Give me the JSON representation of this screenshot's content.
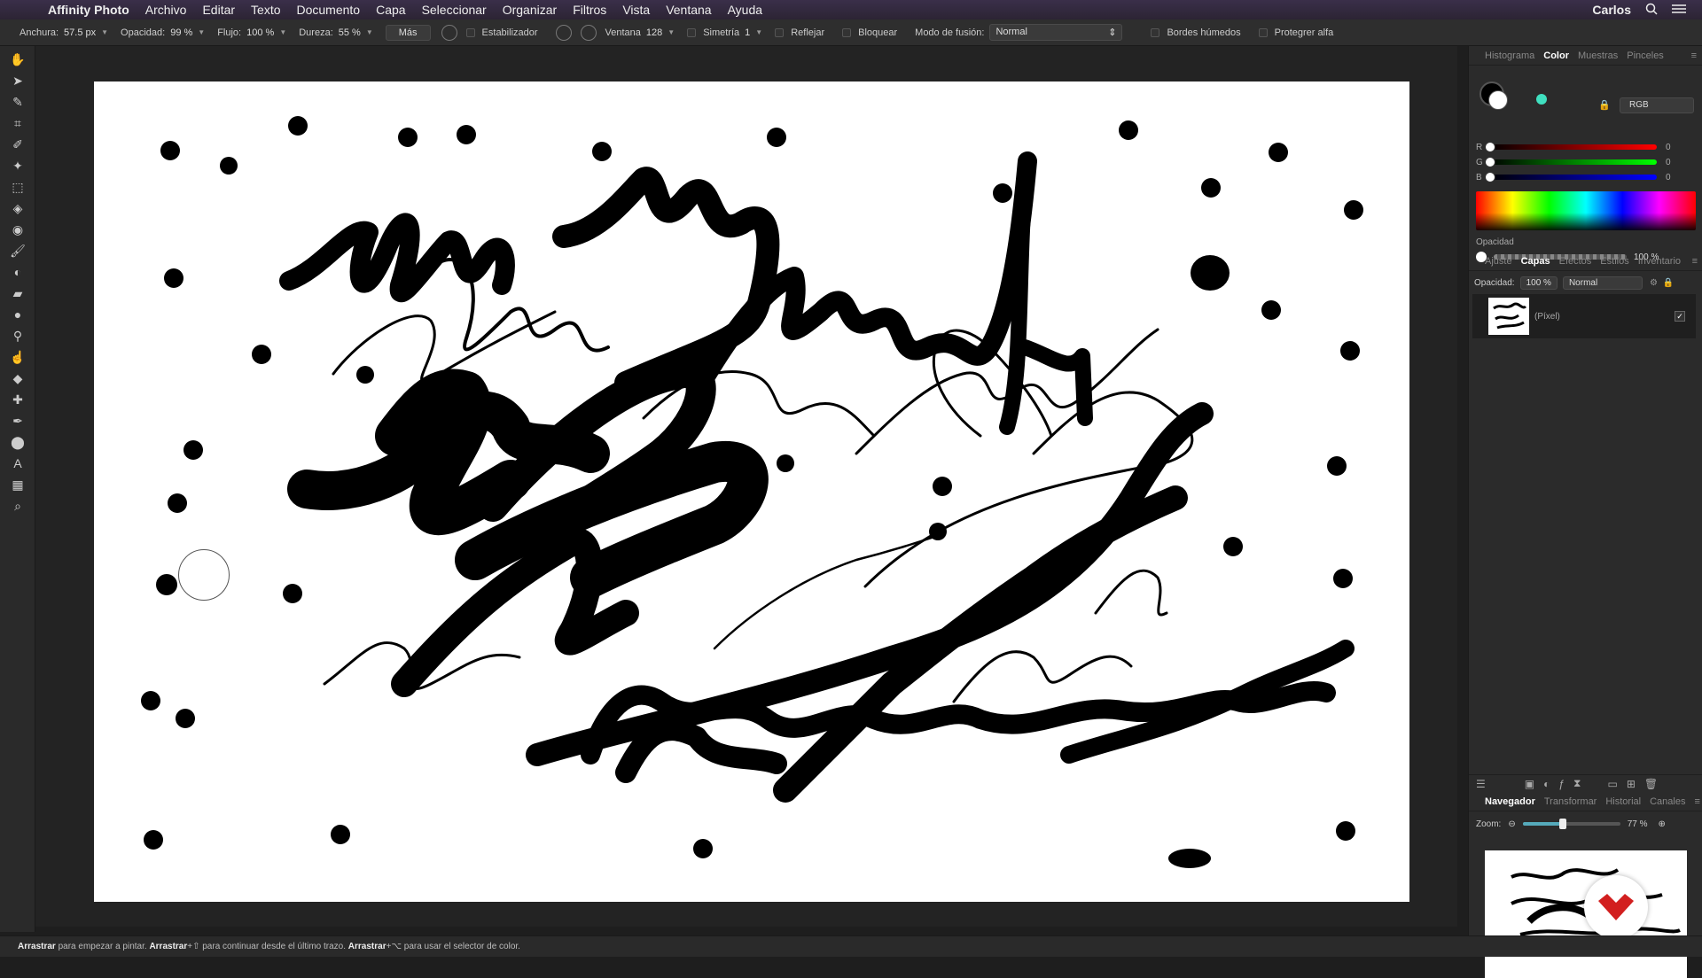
{
  "menubar": {
    "app_name": "Affinity Photo",
    "items": [
      "Archivo",
      "Editar",
      "Texto",
      "Documento",
      "Capa",
      "Seleccionar",
      "Organizar",
      "Filtros",
      "Vista",
      "Ventana",
      "Ayuda"
    ],
    "user": "Carlos"
  },
  "toolbar": {
    "width_label": "Anchura:",
    "width_value": "57.5 px",
    "opacity_label": "Opacidad:",
    "opacity_value": "99 %",
    "flow_label": "Flujo:",
    "flow_value": "100 %",
    "hardness_label": "Dureza:",
    "hardness_value": "55 %",
    "more_label": "Más",
    "stabilizer_label": "Estabilizador",
    "window_label": "Ventana",
    "window_value": "128",
    "symmetry_label": "Simetría",
    "symmetry_value": "1",
    "reflect_label": "Reflejar",
    "lock_label": "Bloquear",
    "blend_label": "Modo de fusión:",
    "blend_value": "Normal",
    "wet_edges_label": "Bordes húmedos",
    "protect_alpha_label": "Protegrer alfa"
  },
  "color_panel": {
    "tabs": [
      "Histograma",
      "Color",
      "Muestras",
      "Pinceles"
    ],
    "active_tab": "Color",
    "model": "RGB",
    "r_label": "R",
    "r_value": "0",
    "g_label": "G",
    "g_value": "0",
    "b_label": "B",
    "b_value": "0",
    "opacity_label": "Opacidad",
    "opacity_value": "100 %",
    "accent_color": "#40e0c0"
  },
  "layers_panel": {
    "tabs": [
      "Ajuste",
      "Capas",
      "Efectos",
      "Estilos",
      "Inventario"
    ],
    "active_tab": "Capas",
    "opacity_label": "Opacidad:",
    "opacity_value": "100 %",
    "blend_value": "Normal",
    "layer_name": "(Píxel)"
  },
  "navigator_panel": {
    "tabs": [
      "Navegador",
      "Transformar",
      "Historial",
      "Canales"
    ],
    "active_tab": "Navegador",
    "zoom_label": "Zoom:",
    "zoom_value": "77 %"
  },
  "statusbar": {
    "part1_bold": "Arrastrar",
    "part1": " para empezar a pintar. ",
    "part2_bold": "Arrastrar",
    "part2": "+⇧ para continuar desde el último trazo. ",
    "part3_bold": "Arrastrar",
    "part3": "+⌥ para usar el selector de color."
  }
}
